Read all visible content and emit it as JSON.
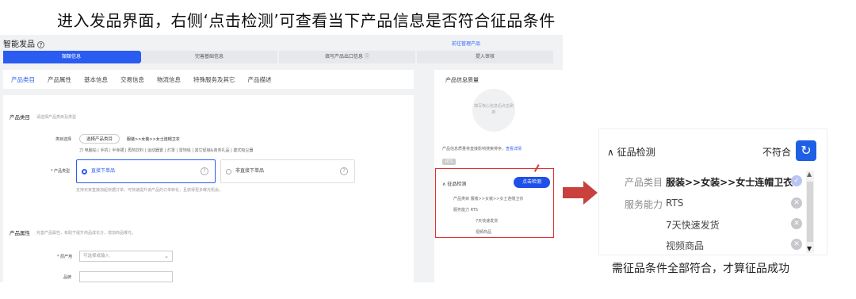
{
  "headline": "进入发品界面，右侧‘点击检测’可查看当下产品信息是否符合征品条件",
  "caption": "需征品条件全部符合，才算征品成功",
  "screenshot": {
    "title": "智能发品",
    "link": "前往管理产品",
    "steps": [
      "類類信息",
      "完善基础信息",
      "填写产品出口信息 ⓘ",
      "提入审核"
    ],
    "tabs": [
      "产品类目",
      "产品属性",
      "基本信息",
      "交易信息",
      "物流信息",
      "特殊服务及其它",
      "产品描述"
    ],
    "category_section": {
      "title": "产品类目",
      "hint": "请选择产品类目及类型",
      "select_label": "类目选择",
      "select_button": "选择产品类目",
      "select_value": "服装>>女装>>女士连帽卫衣",
      "recent": "刀  电脑钻  |  手机  |  半身裙  |  再热饮料  |  运动器置  |  灯罩  |  雷地毯  |  其它促销&商务礼品  |  建式吸尘器",
      "type_label": "* 产品类型",
      "type_option_1": "直接下单品",
      "type_option_2": "非直接下单品",
      "type_note": "支持买家直接加起依据订单，可快速提升该产品的订单转化，且获得更多曝光机会。"
    },
    "attr_section": {
      "title": "产品属性",
      "hint": "完善产品属性，有助于提升商品成长分，增加商品曝光。",
      "origin_label": "* 原产地",
      "origin_placeholder": "可选择或输入",
      "brand_label": "品牌"
    },
    "quality": {
      "title": "产品信息质量",
      "circle_text": "填写核心信息后点击刷新",
      "note": "产品信息质量将直接影响搜索排序，",
      "note_link": "查看详情",
      "tag": "RTS"
    },
    "check_box": {
      "title": "征品检测",
      "button": "点击检测",
      "line1": "产品类目  服装>>女装>>女士连帽卫衣",
      "line2": "服务能力  RTS",
      "line3": "7天快速发货",
      "line4": "视频商品"
    }
  },
  "zoom": {
    "header": "征品检测",
    "status": "不符合",
    "rows": [
      {
        "key": "产品类目",
        "value": "服装>>女装>>女士连帽卫衣"
      },
      {
        "key": "服务能力",
        "value": "RTS"
      },
      {
        "key": "",
        "value": "7天快速发货"
      },
      {
        "key": "",
        "value": "视频商品"
      }
    ]
  }
}
